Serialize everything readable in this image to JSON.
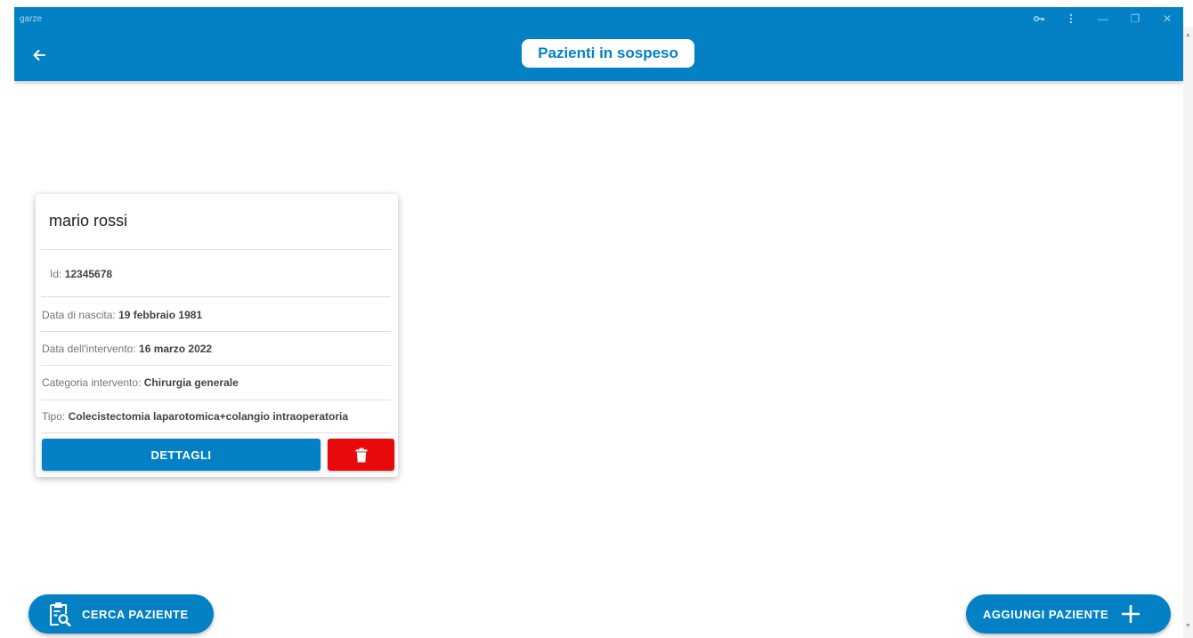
{
  "window": {
    "title": "garze",
    "controls": {
      "key_icon": "key-icon",
      "menu_icon": "more-vertical-icon",
      "minimize_glyph": "—",
      "restore_glyph": "❐",
      "close_glyph": "✕"
    }
  },
  "appbar": {
    "back_icon": "arrow-left-icon",
    "title": "Pazienti in sospeso",
    "color": "#0381c4"
  },
  "patient_card": {
    "name": "mario rossi",
    "id_label": "Id:",
    "id_value": "12345678",
    "birth_label": "Data di nascita:",
    "birth_value": "19 febbraio 1981",
    "surgery_date_label": "Data dell'intervento:",
    "surgery_date_value": "16 marzo 2022",
    "category_label": "Categoria intervento:",
    "category_value": "Chirurgia generale",
    "type_label": "Tipo:",
    "type_value": "Colecistectomia laparotomica+colangio intraoperatoria",
    "details_button": "DETTAGLI",
    "delete_icon": "trash-icon",
    "delete_color": "#e80a0a"
  },
  "actions": {
    "search_button": "CERCA PAZIENTE",
    "search_icon": "clipboard-search-icon",
    "add_button": "AGGIUNGI PAZIENTE",
    "add_icon": "plus-icon"
  }
}
